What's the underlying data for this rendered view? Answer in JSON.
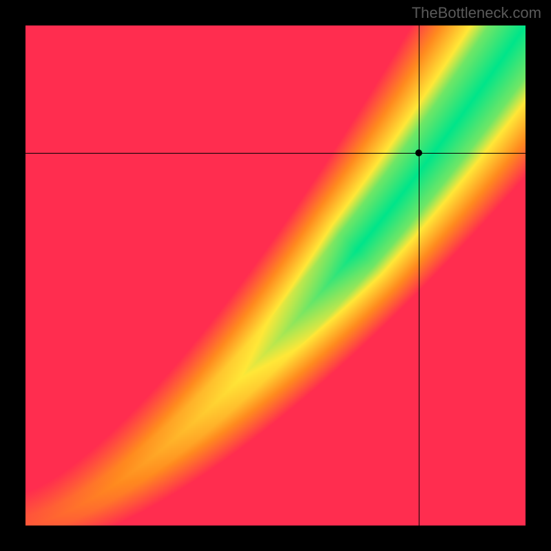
{
  "watermark": "TheBottleneck.com",
  "chart_data": {
    "type": "heatmap",
    "title": "",
    "xlabel": "",
    "ylabel": "",
    "xlim": [
      0,
      1
    ],
    "ylim": [
      0,
      1
    ],
    "grid": false,
    "legend": false,
    "resolution": 110,
    "color_stops": {
      "red": "#ff2d4f",
      "orange": "#ff8a1f",
      "yellow": "#ffe838",
      "green": "#00e58a"
    },
    "ridge": {
      "description": "diagonal optimum band from lower-left to upper-right; peak (green) where components are balanced",
      "curve_exponent": 1.45,
      "width_base": 0.018,
      "width_growth": 0.09,
      "shoulder_mult": 2.6
    },
    "crosshair": {
      "x": 0.787,
      "y": 0.745
    },
    "marker": {
      "x": 0.787,
      "y": 0.745
    }
  }
}
